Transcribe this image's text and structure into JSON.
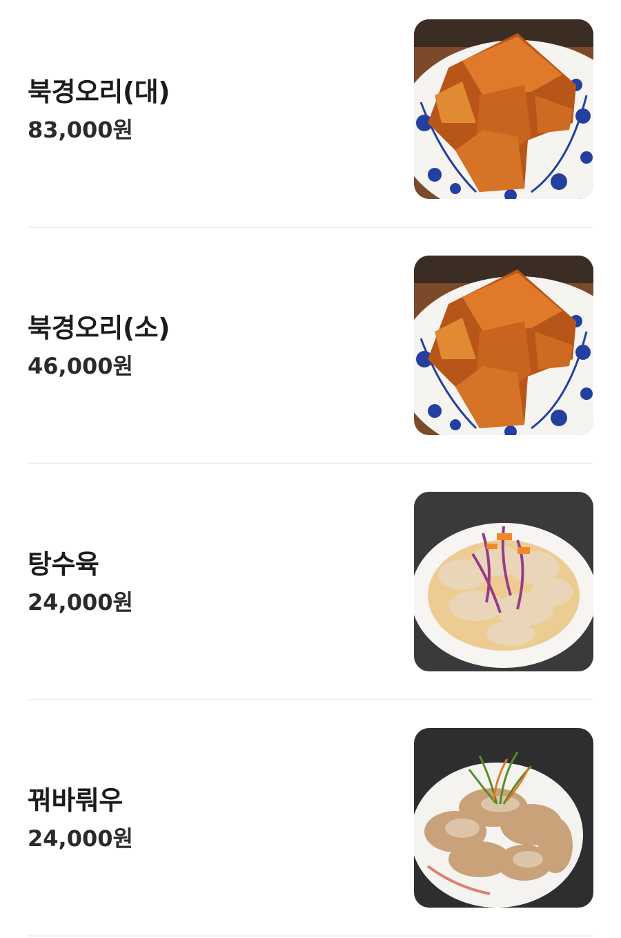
{
  "menu": {
    "items": [
      {
        "name": "북경오리(대)",
        "price": "83,000원",
        "image": "peking-duck-photo"
      },
      {
        "name": "북경오리(소)",
        "price": "46,000원",
        "image": "peking-duck-photo"
      },
      {
        "name": "탕수육",
        "price": "24,000원",
        "image": "sweet-and-sour-pork-photo"
      },
      {
        "name": "꿔바뤄우",
        "price": "24,000원",
        "image": "guobaorou-photo"
      }
    ]
  }
}
